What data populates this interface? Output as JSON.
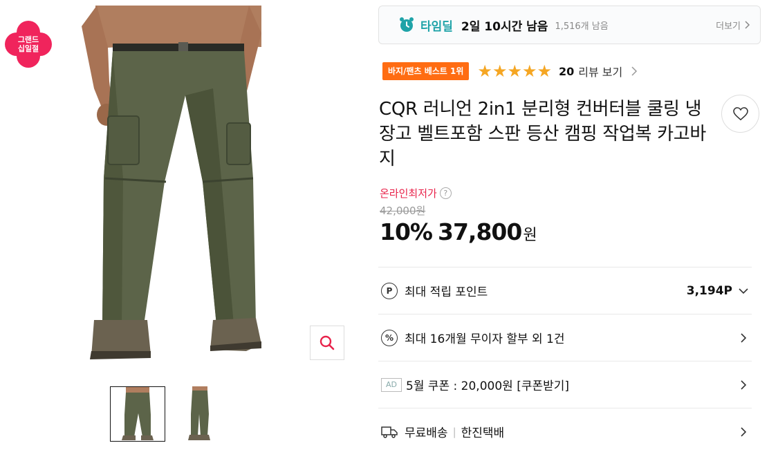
{
  "brand_badge": {
    "line1": "그랜드",
    "line2": "십일절",
    "color": "#f0245c"
  },
  "timedeal": {
    "title": "타임딜",
    "remaining": "2일 10시간 남음",
    "count": "1,516개 남음",
    "more": "더보기",
    "accent": "#1fa3a8"
  },
  "rank_badge": "바지/팬츠 베스트 1위",
  "rating": {
    "stars": 5,
    "review_count": "20",
    "review_link": "리뷰 보기"
  },
  "product": {
    "title": "CQR 러니언 2in1 분리형 컨버터블 쿨링 냉장고 벨트포함 스판 등산 캠핑 작업복 카고바지",
    "lowest_label": "온라인최저가",
    "original_price": "42,000원",
    "discount": "10%",
    "price": "37,800",
    "currency": "원"
  },
  "benefits": {
    "points_label": "최대 적립 포인트",
    "points_value": "3,194P",
    "installment": "최대 16개월 무이자 할부 외 1건",
    "ad_tag": "AD",
    "coupon": "5월 쿠폰 : 20,000원 [쿠폰받기]",
    "shipping": "무료배송",
    "courier": "한진택배"
  }
}
